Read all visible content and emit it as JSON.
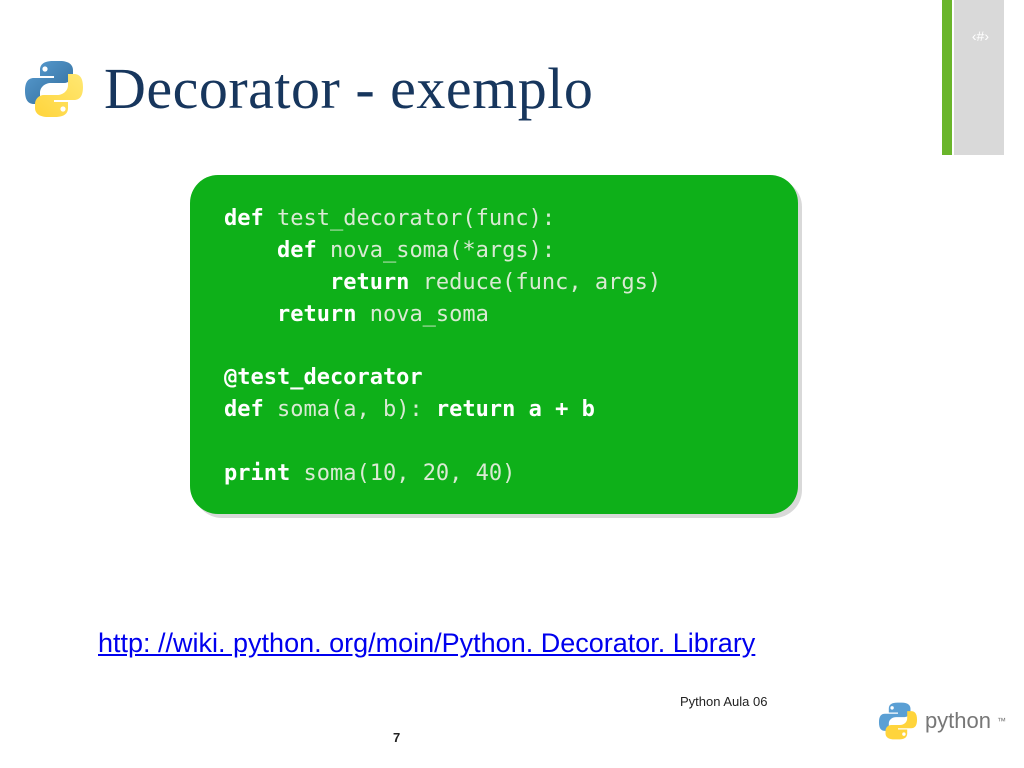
{
  "corner_marker": "‹#›",
  "header": {
    "title": "Decorator - exemplo"
  },
  "code": {
    "lines": [
      {
        "tokens": [
          {
            "t": "def ",
            "b": true
          },
          {
            "t": "test_decorator(func):",
            "b": false
          }
        ]
      },
      {
        "tokens": [
          {
            "t": "    def ",
            "b": true
          },
          {
            "t": "nova_soma(*args):",
            "b": false
          }
        ]
      },
      {
        "tokens": [
          {
            "t": "        return ",
            "b": true
          },
          {
            "t": "reduce(func, args)",
            "b": false
          }
        ]
      },
      {
        "tokens": [
          {
            "t": "    return ",
            "b": true
          },
          {
            "t": "nova_soma",
            "b": false
          }
        ]
      },
      {
        "tokens": [
          {
            "t": " ",
            "b": false
          }
        ]
      },
      {
        "tokens": [
          {
            "t": "@test_decorator",
            "b": true
          }
        ]
      },
      {
        "tokens": [
          {
            "t": "def ",
            "b": true
          },
          {
            "t": "soma(a, b): ",
            "b": false
          },
          {
            "t": "return a + b",
            "b": true
          }
        ]
      },
      {
        "tokens": [
          {
            "t": " ",
            "b": false
          }
        ]
      },
      {
        "tokens": [
          {
            "t": "print ",
            "b": true
          },
          {
            "t": "soma(10, 20, 40)",
            "b": false
          }
        ]
      }
    ]
  },
  "link": {
    "text": "http: //wiki. python. org/moin/Python. Decorator. Library"
  },
  "footer": {
    "course_label": "Python   Aula 06",
    "page_number": "7",
    "brand": "python",
    "tm": "™"
  }
}
